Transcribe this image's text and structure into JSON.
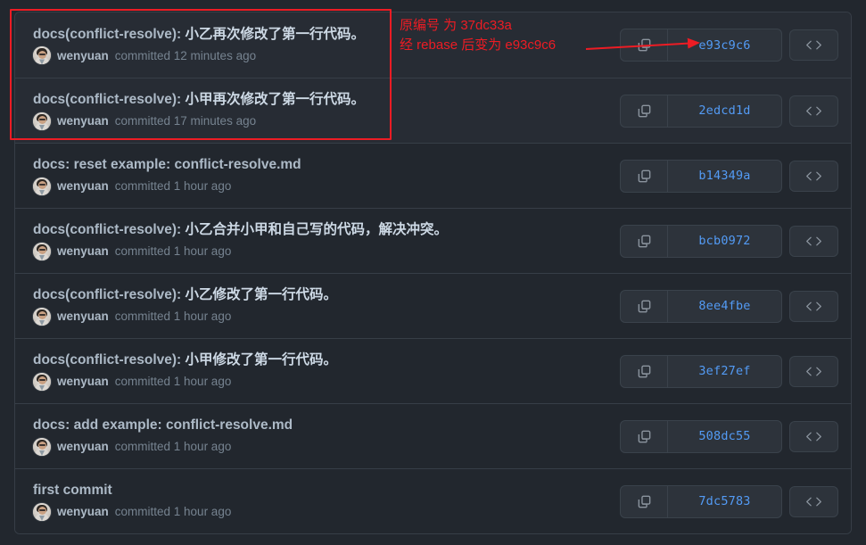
{
  "window": {
    "background_color": "#22272e",
    "card_border_color": "#373e47"
  },
  "colors": {
    "accent_link": "#539bf5",
    "annotation_red": "#ed1c24",
    "title_text": "#cdd9e5",
    "muted_text": "#768390"
  },
  "commits": [
    {
      "scope": "docs(conflict-resolve): ",
      "subject": "小乙再次修改了第一行代码。",
      "author": "wenyuan",
      "committed": "committed 12 minutes ago",
      "sha": "e93c9c6",
      "copy_icon": "copy-icon",
      "code_icon": "code-icon",
      "highlighted": true
    },
    {
      "scope": "docs(conflict-resolve): ",
      "subject": "小甲再次修改了第一行代码。",
      "author": "wenyuan",
      "committed": "committed 17 minutes ago",
      "sha": "2edcd1d",
      "copy_icon": "copy-icon",
      "code_icon": "code-icon",
      "highlighted": true
    },
    {
      "scope": "docs: reset example: conflict-resolve.md",
      "subject": "",
      "author": "wenyuan",
      "committed": "committed 1 hour ago",
      "sha": "b14349a",
      "copy_icon": "copy-icon",
      "code_icon": "code-icon",
      "highlighted": false
    },
    {
      "scope": "docs(conflict-resolve): ",
      "subject": "小乙合并小甲和自己写的代码，解决冲突。",
      "author": "wenyuan",
      "committed": "committed 1 hour ago",
      "sha": "bcb0972",
      "copy_icon": "copy-icon",
      "code_icon": "code-icon",
      "highlighted": false
    },
    {
      "scope": "docs(conflict-resolve): ",
      "subject": "小乙修改了第一行代码。",
      "author": "wenyuan",
      "committed": "committed 1 hour ago",
      "sha": "8ee4fbe",
      "copy_icon": "copy-icon",
      "code_icon": "code-icon",
      "highlighted": false
    },
    {
      "scope": "docs(conflict-resolve): ",
      "subject": "小甲修改了第一行代码。",
      "author": "wenyuan",
      "committed": "committed 1 hour ago",
      "sha": "3ef27ef",
      "copy_icon": "copy-icon",
      "code_icon": "code-icon",
      "highlighted": false
    },
    {
      "scope": "docs: add example: conflict-resolve.md",
      "subject": "",
      "author": "wenyuan",
      "committed": "committed 1 hour ago",
      "sha": "508dc55",
      "copy_icon": "copy-icon",
      "code_icon": "code-icon",
      "highlighted": false
    },
    {
      "scope": "first commit",
      "subject": "",
      "author": "wenyuan",
      "committed": "committed 1 hour ago",
      "sha": "7dc5783",
      "copy_icon": "copy-icon",
      "code_icon": "code-icon",
      "highlighted": false
    }
  ],
  "annotation": {
    "line1": "原编号 为 37dc33a",
    "line2": "经 rebase 后变为 e93c9c6",
    "arrow_target_sha": "e93c9c6",
    "box_label": "highlighted-commits-box"
  }
}
